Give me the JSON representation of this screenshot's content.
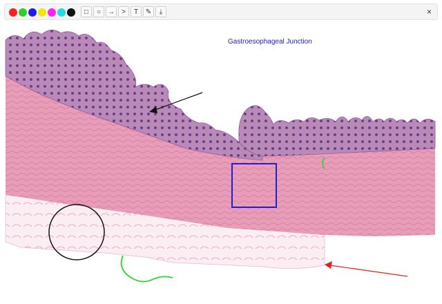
{
  "toolbar": {
    "colors": [
      "#ff2020",
      "#2ecc2e",
      "#1e1ee6",
      "#f2e600",
      "#ff22ff",
      "#22dddd",
      "#111111"
    ],
    "tools": [
      {
        "name": "rectangle-tool",
        "glyph": "□"
      },
      {
        "name": "circle-tool",
        "glyph": "○"
      },
      {
        "name": "arrow-tool",
        "glyph": "→"
      },
      {
        "name": "chevron-tool",
        "glyph": ">"
      },
      {
        "name": "text-tool",
        "glyph": "T"
      },
      {
        "name": "pencil-tool",
        "glyph": "✎"
      },
      {
        "name": "download-tool",
        "glyph": "⤓"
      }
    ],
    "close_glyph": "×"
  },
  "annotation": {
    "title": "Gastroesophageal Junction"
  }
}
